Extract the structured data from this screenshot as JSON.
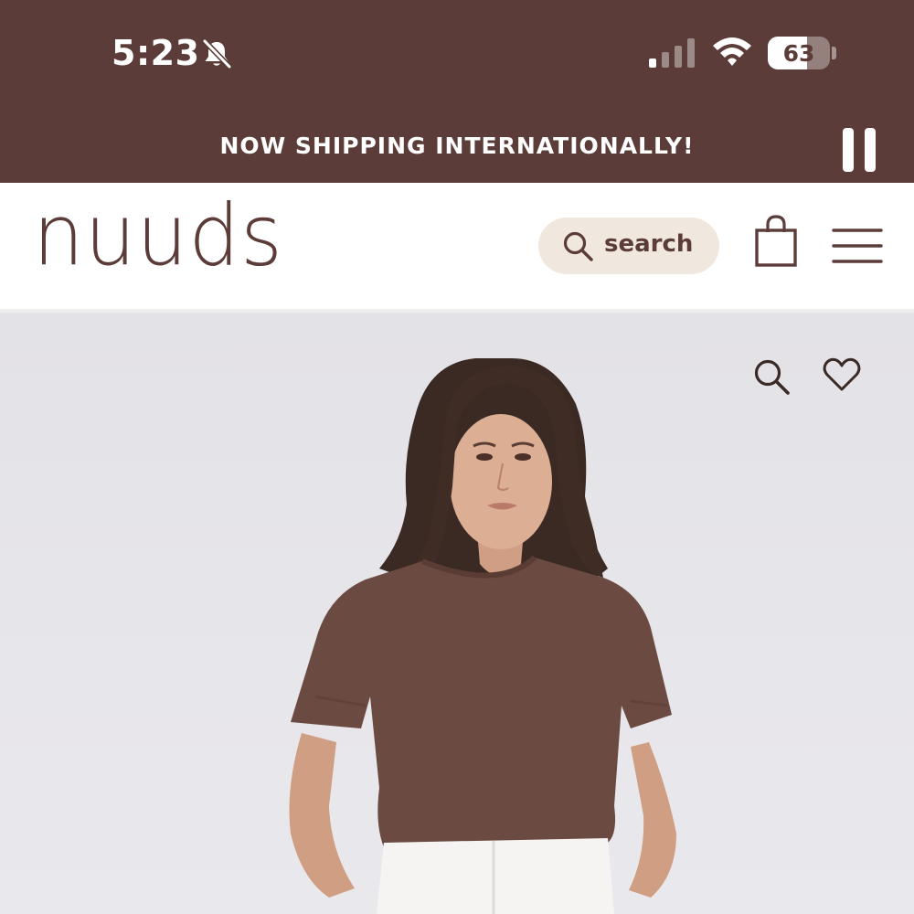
{
  "status_bar": {
    "time": "5:23",
    "battery_percent": "63",
    "battery_level": 0.63,
    "icons": [
      "bell-muted-icon",
      "cellular-signal-icon",
      "wifi-icon",
      "battery-icon"
    ]
  },
  "announcement": {
    "text": "NOW SHIPPING INTERNATIONALLY!",
    "control_icon": "pause-icon"
  },
  "header": {
    "logo": "nuuds",
    "search_label": "search",
    "icons": [
      "search-icon",
      "shopping-bag-icon",
      "hamburger-menu-icon"
    ]
  },
  "product_image": {
    "icons": [
      "zoom-icon",
      "heart-icon"
    ]
  },
  "colors": {
    "brand": "#5b3c38",
    "search_pill_bg": "#f0e8de",
    "hero_bg": "#e5e4e8",
    "shirt": "#6b4a41"
  }
}
